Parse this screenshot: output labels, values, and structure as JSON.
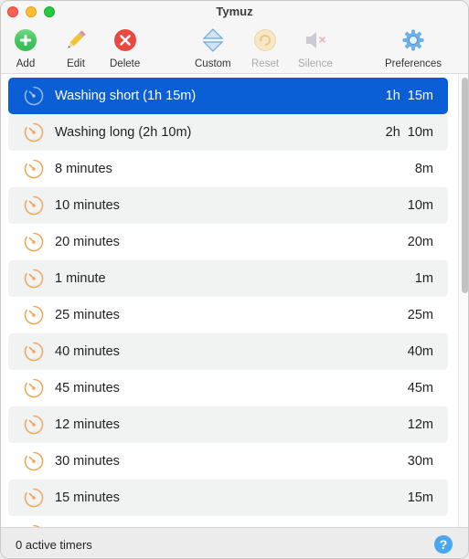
{
  "window": {
    "title": "Tymuz"
  },
  "toolbar": {
    "add": {
      "label": "Add",
      "icon": "plus-circle-icon",
      "color": "#2fbf4f"
    },
    "edit": {
      "label": "Edit",
      "icon": "pencil-icon"
    },
    "delete": {
      "label": "Delete",
      "icon": "delete-circle-icon",
      "color": "#e8453c"
    },
    "custom": {
      "label": "Custom",
      "icon": "up-down-arrows-icon"
    },
    "reset": {
      "label": "Reset",
      "icon": "refresh-icon",
      "disabled": true
    },
    "silence": {
      "label": "Silence",
      "icon": "speaker-mute-icon",
      "disabled": true
    },
    "preferences": {
      "label": "Preferences",
      "icon": "gear-icon"
    }
  },
  "timers": [
    {
      "name": "Washing short (1h 15m)",
      "duration": "1h 15m",
      "selected": true
    },
    {
      "name": "Washing long (2h 10m)",
      "duration": "2h 10m"
    },
    {
      "name": "8 minutes",
      "duration": "8m"
    },
    {
      "name": "10 minutes",
      "duration": "10m"
    },
    {
      "name": "20 minutes",
      "duration": "20m"
    },
    {
      "name": "1 minute",
      "duration": "1m"
    },
    {
      "name": "25 minutes",
      "duration": "25m"
    },
    {
      "name": "40 minutes",
      "duration": "40m"
    },
    {
      "name": "45 minutes",
      "duration": "45m"
    },
    {
      "name": "12 minutes",
      "duration": "12m"
    },
    {
      "name": "30 minutes",
      "duration": "30m"
    },
    {
      "name": "15 minutes",
      "duration": "15m"
    },
    {
      "name": "",
      "duration": ""
    }
  ],
  "status": {
    "text": "0 active timers",
    "help_label": "?"
  },
  "colors": {
    "selection": "#0a5fd7",
    "clock_icon": "#f0a860",
    "row_alt": "#f1f2f2"
  }
}
